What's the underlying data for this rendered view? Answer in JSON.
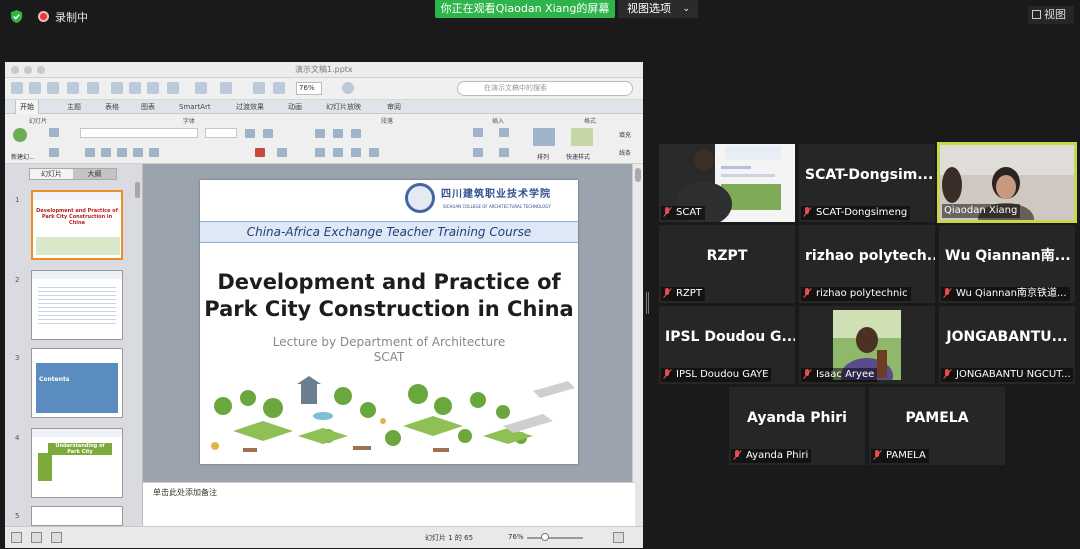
{
  "topbar": {
    "recording_label": "录制中",
    "share_banner": "你正在观看Qiaodan Xiang的屏幕",
    "view_options": "视图选项",
    "view_button": "视图"
  },
  "shared": {
    "doc_title": "演示文稿1.pptx",
    "zoom": "76%",
    "search_placeholder": "在演示文稿中的搜索",
    "tabs": [
      "开始",
      "主题",
      "表格",
      "图表",
      "SmartArt",
      "过渡效果",
      "动画",
      "幻灯片放映",
      "审阅"
    ],
    "groups": {
      "slides": "幻灯片",
      "font": "字体",
      "paragraph": "段落",
      "insert": "插入",
      "format": "格式"
    },
    "new_slide": "新建幻...",
    "arrange": "排列",
    "quick_styles": "快速样式",
    "fill": "填充",
    "line": "线条",
    "side_tabs": [
      "幻灯片",
      "大纲"
    ],
    "thumbs": [
      {
        "num": "1",
        "title": "Development and Practice of Park City Construction in China"
      },
      {
        "num": "2",
        "title": ""
      },
      {
        "num": "3",
        "title": "Contents"
      },
      {
        "num": "4",
        "title": "Understanding of Park City"
      },
      {
        "num": "5",
        "title": ""
      }
    ],
    "slide": {
      "logo_cn": "四川建筑职业技术学院",
      "logo_en": "SICHUAN COLLEGE OF ARCHITECTURAL TECHNOLOGY",
      "band": "China-Africa Exchange Teacher Training Course",
      "title_line1": "Development and Practice of",
      "title_line2": "Park City Construction in China",
      "subtitle1": "Lecture by Department of Architecture",
      "subtitle2": "SCAT"
    },
    "notes_placeholder": "单击此处添加备注",
    "status_slide": "幻灯片 1 的 65",
    "status_zoom": "76%"
  },
  "participants": [
    {
      "id": "scat",
      "label": "SCAT",
      "big": "",
      "video": true
    },
    {
      "id": "scat-dongsimeng",
      "label": "SCAT-Dongsimeng",
      "big": "SCAT-Dongsim..."
    },
    {
      "id": "qiaodan",
      "label": "Qiaodan Xiang",
      "big": "",
      "video": true,
      "active": true
    },
    {
      "id": "rzpt",
      "label": "RZPT",
      "big": "RZPT"
    },
    {
      "id": "rizhao",
      "label": "rizhao polytechnic",
      "big": "rizhao polytech..."
    },
    {
      "id": "wu",
      "label": "Wu Qiannan南京铁道...",
      "big": "Wu Qiannan南..."
    },
    {
      "id": "ipsl",
      "label": "IPSL Doudou GAYE",
      "big": "IPSL Doudou G..."
    },
    {
      "id": "isaac",
      "label": "Isaac Aryee",
      "big": "",
      "video": true
    },
    {
      "id": "jongabantu",
      "label": "JONGABANTU NGCUT...",
      "big": "JONGABANTU..."
    },
    {
      "id": "ayanda",
      "label": "Ayanda Phiri",
      "big": "Ayanda Phiri"
    },
    {
      "id": "pamela",
      "label": "PAMELA",
      "big": "PAMELA"
    }
  ],
  "colors": {
    "share_green": "#2db44a",
    "active_border": "#c7d94a",
    "mute_red": "#e24a4a",
    "slide_band": "#dfe8f7"
  }
}
